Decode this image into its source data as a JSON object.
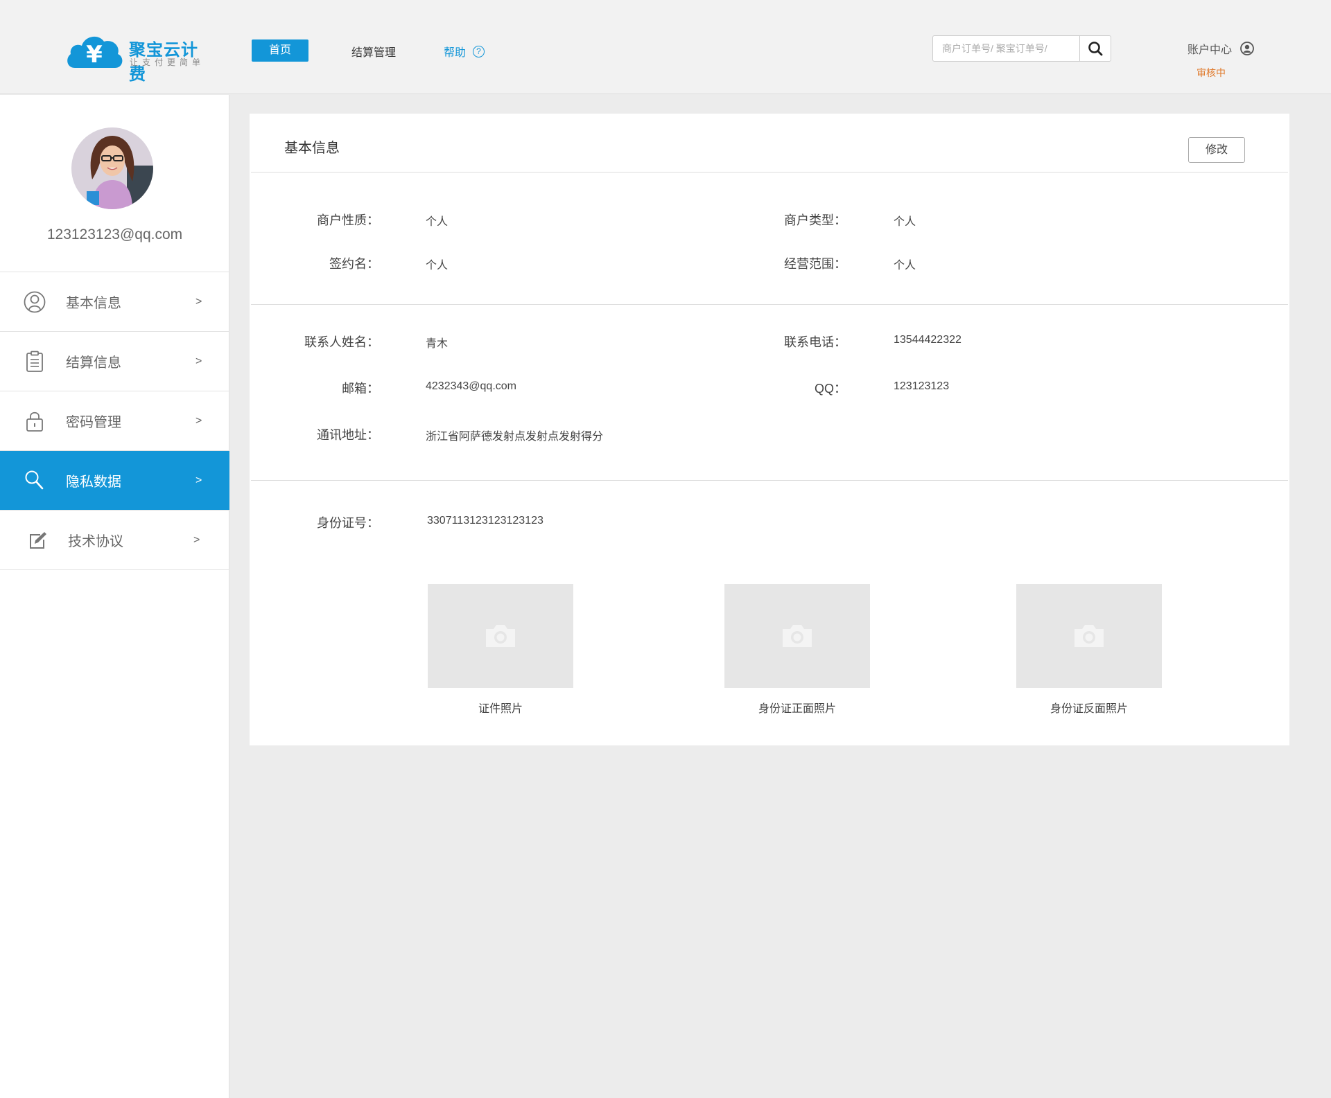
{
  "header": {
    "logo_title": "聚宝云计费",
    "logo_slogan": "让支付更简单",
    "nav_home": "首页",
    "nav_settlement": "结算管理",
    "nav_help": "帮助",
    "search_placeholder": "商户订单号/ 聚宝订单号/",
    "account_label": "账户中心",
    "audit_status": "审核中"
  },
  "sidebar": {
    "email": "123123123@qq.com",
    "items": [
      {
        "label": "基本信息",
        "arrow": ">",
        "icon": "user-circle-icon"
      },
      {
        "label": "结算信息",
        "arrow": ">",
        "icon": "clipboard-icon"
      },
      {
        "label": "密码管理",
        "arrow": ">",
        "icon": "lock-icon"
      },
      {
        "label": "隐私数据",
        "arrow": ">",
        "icon": "search-icon",
        "active": true
      },
      {
        "label": "技术协议",
        "arrow": ">",
        "icon": "edit-icon"
      }
    ]
  },
  "panel": {
    "title": "基本信息",
    "edit_button": "修改",
    "merchant": {
      "nature_label": "商户性质：",
      "nature_value": "个人",
      "type_label": "商户类型：",
      "type_value": "个人",
      "sign_name_label": "签约名：",
      "sign_name_value": "个人",
      "scope_label": "经营范围：",
      "scope_value": "个人"
    },
    "contact": {
      "name_label": "联系人姓名：",
      "name_value": "青木",
      "phone_label": "联系电话：",
      "phone_value": "13544422322",
      "email_label": "邮箱：",
      "email_value": "4232343@qq.com",
      "qq_label": "QQ：",
      "qq_value": "123123123",
      "address_label": "通讯地址：",
      "address_value": "浙江省阿萨德发射点发射点发射得分"
    },
    "identity": {
      "id_label": "身份证号：",
      "id_value": "3307113123123123123",
      "photos": [
        {
          "caption": "证件照片"
        },
        {
          "caption": "身份证正面照片"
        },
        {
          "caption": "身份证反面照片"
        }
      ]
    }
  },
  "colors": {
    "brand_blue": "#1396d8",
    "audit_orange": "#e07a2c",
    "page_bg": "#ececec"
  }
}
